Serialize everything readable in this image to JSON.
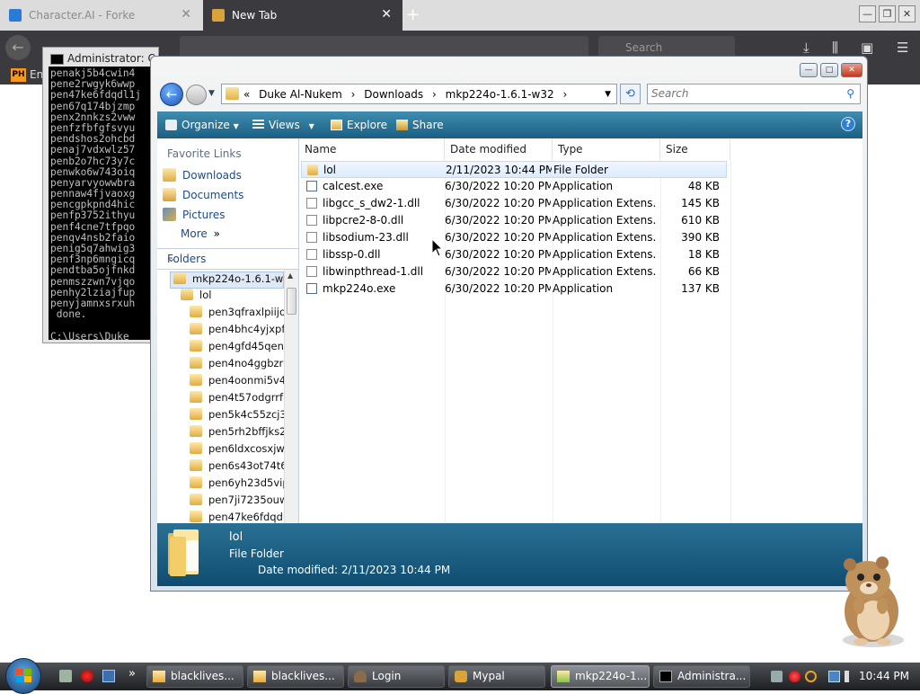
{
  "firefox": {
    "tabs": [
      {
        "title": "Character.AI - Forke",
        "active": false
      },
      {
        "title": "New Tab",
        "active": true
      }
    ],
    "search_placeholder": "Search",
    "bookmark_label": "En"
  },
  "cmd": {
    "title": "Administrator: C:\\...",
    "lines": [
      "penakj5b4cwin4",
      "pene2rwgyk6wwp",
      "pen47ke6fdqdl1j",
      "pen67q174bjzmp",
      "penx2nnkzs2vww",
      "penfzfbfgfsvyu",
      "pendshos2ohcbd",
      "penaj7vdxwlz57",
      "penb2o7hc73y7c",
      "penwko6w743oiq",
      "penyarvyowwbra",
      "pennaw4fjvaoxg",
      "pencgpkpnd4hic",
      "penfp3752ithyu",
      "penf4cne7tfpqo",
      "penqv4nsb2faio",
      "penig5q7ahwig3",
      "penf3np6mngicq",
      "pendtba5ojfnkd",
      "penmszzwn7vjqo",
      "penhy2lziajfup",
      "penyjamnxsrxuh",
      " done.",
      "",
      "C:\\Users\\Duke"
    ]
  },
  "explorer": {
    "breadcrumb": [
      "«",
      "Duke Al-Nukem",
      "›",
      "Downloads",
      "›",
      "mkp224o-1.6.1-w32",
      "›"
    ],
    "search_placeholder": "Search",
    "toolbar": {
      "organize": "Organize",
      "views": "Views",
      "explore": "Explore",
      "share": "Share",
      "help": "?"
    },
    "favorites": {
      "title": "Favorite Links",
      "items": [
        "Downloads",
        "Documents",
        "Pictures",
        "More"
      ],
      "more_arrow": "»"
    },
    "folders_label": "Folders",
    "tree": [
      {
        "label": "mkp224o-1.6.1-w3",
        "level": 0
      },
      {
        "label": "lol",
        "level": 1
      },
      {
        "label": "pen3qfraxlpiijo",
        "level": 2
      },
      {
        "label": "pen4bhc4yjxpf",
        "level": 2
      },
      {
        "label": "pen4gfd45qen",
        "level": 2
      },
      {
        "label": "pen4no4ggbzr",
        "level": 2
      },
      {
        "label": "pen4oonmi5v4",
        "level": 2
      },
      {
        "label": "pen4t57odgrrf",
        "level": 2
      },
      {
        "label": "pen5k4c55zcj3",
        "level": 2
      },
      {
        "label": "pen5rh2bffjks2",
        "level": 2
      },
      {
        "label": "pen6ldxcosxjw",
        "level": 2
      },
      {
        "label": "pen6s43ot74t6",
        "level": 2
      },
      {
        "label": "pen6yh23d5vip",
        "level": 2
      },
      {
        "label": "pen7ji7235ouw",
        "level": 2
      },
      {
        "label": "pen47ke6fdqdl",
        "level": 2
      }
    ],
    "columns": [
      "Name",
      "Date modified",
      "Type",
      "Size"
    ],
    "files": [
      {
        "name": "lol",
        "date": "2/11/2023 10:44 PM",
        "type": "File Folder",
        "size": "",
        "kind": "folder"
      },
      {
        "name": "calcest.exe",
        "date": "6/30/2022 10:20 PM",
        "type": "Application",
        "size": "48 KB",
        "kind": "app"
      },
      {
        "name": "libgcc_s_dw2-1.dll",
        "date": "6/30/2022 10:20 PM",
        "type": "Application Extens...",
        "size": "145 KB",
        "kind": "dll"
      },
      {
        "name": "libpcre2-8-0.dll",
        "date": "6/30/2022 10:20 PM",
        "type": "Application Extens...",
        "size": "610 KB",
        "kind": "dll"
      },
      {
        "name": "libsodium-23.dll",
        "date": "6/30/2022 10:20 PM",
        "type": "Application Extens...",
        "size": "390 KB",
        "kind": "dll"
      },
      {
        "name": "libssp-0.dll",
        "date": "6/30/2022 10:20 PM",
        "type": "Application Extens...",
        "size": "18 KB",
        "kind": "dll"
      },
      {
        "name": "libwinpthread-1.dll",
        "date": "6/30/2022 10:20 PM",
        "type": "Application Extens...",
        "size": "66 KB",
        "kind": "dll"
      },
      {
        "name": "mkp224o.exe",
        "date": "6/30/2022 10:20 PM",
        "type": "Application",
        "size": "137 KB",
        "kind": "app"
      }
    ],
    "details": {
      "name": "lol",
      "type": "File Folder",
      "date": "Date modified: 2/11/2023 10:44 PM"
    }
  },
  "taskbar": {
    "buttons": [
      {
        "label": "blacklives...",
        "active": false
      },
      {
        "label": "blacklives...",
        "active": false
      },
      {
        "label": "Login",
        "active": false
      },
      {
        "label": "Mypal",
        "active": false
      },
      {
        "label": "mkp224o-1...",
        "active": true
      },
      {
        "label": "Administra...",
        "active": false
      }
    ],
    "overflow": "»",
    "clock": "10:44 PM"
  }
}
